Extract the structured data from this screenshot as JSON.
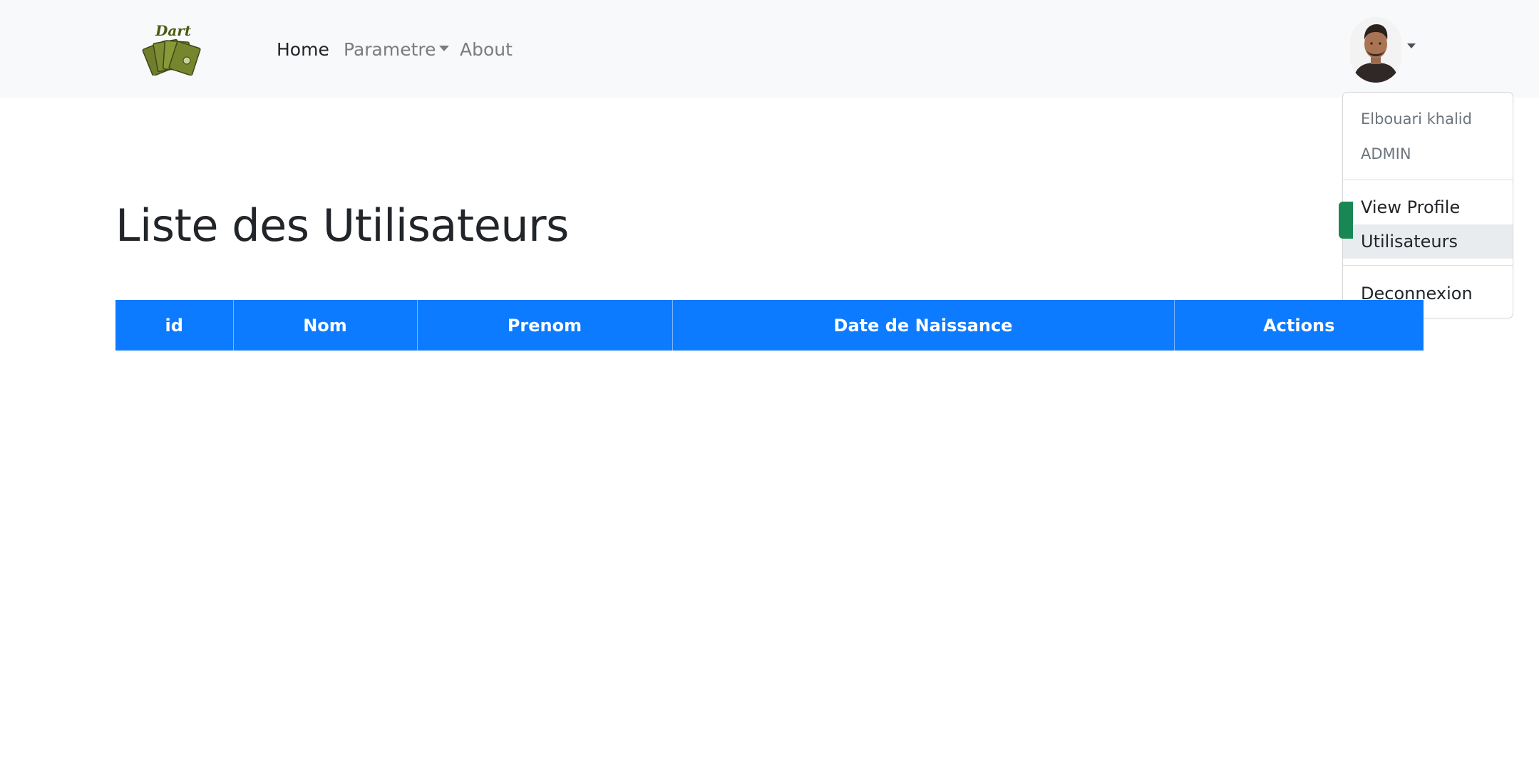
{
  "navbar": {
    "links": [
      {
        "label": "Home",
        "active": true
      },
      {
        "label": "Parametre",
        "dropdown": true
      },
      {
        "label": "About"
      }
    ]
  },
  "user_menu": {
    "name": "Elbouari khalid",
    "role": "ADMIN",
    "items": [
      "View Profile",
      "Utilisateurs",
      "Deconnexion"
    ],
    "highlighted_item": "Utilisateurs"
  },
  "page": {
    "title": "Liste des Utilisateurs"
  },
  "table": {
    "headers": [
      "id",
      "Nom",
      "Prenom",
      "Date de Naissance",
      "Actions"
    ],
    "rows": []
  },
  "colors": {
    "navbar_bg": "#f8f9fa",
    "table_header_bg": "#0d7bff",
    "add_button": "#198754"
  }
}
